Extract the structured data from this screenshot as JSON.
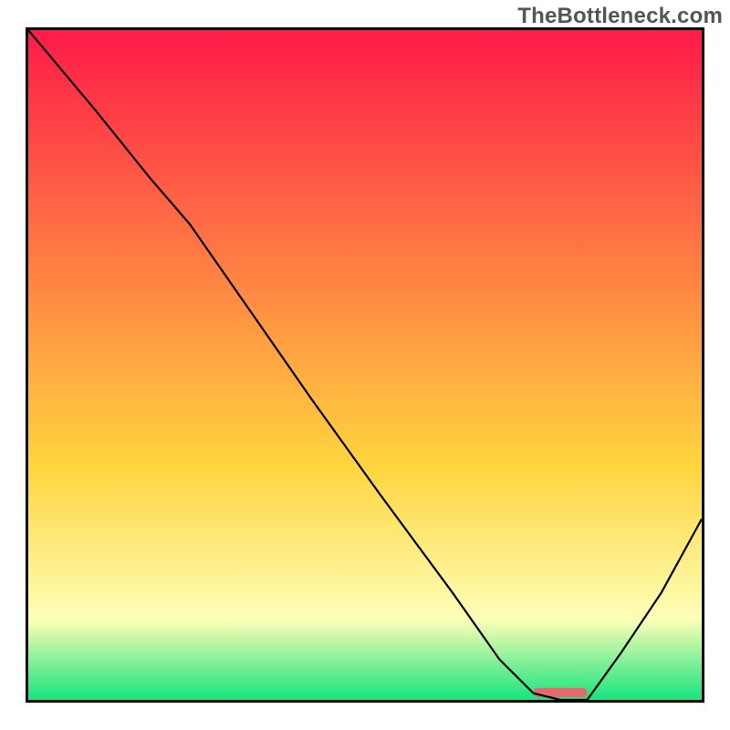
{
  "watermark": "TheBottleneck.com",
  "colors": {
    "gradient_top": "#fe1b48",
    "gradient_mid1": "#ff7544",
    "gradient_mid2": "#ffd53f",
    "gradient_pale": "#fdfeb7",
    "gradient_green": "#16e47d",
    "curve_stroke": "#000000",
    "marker_fill": "#e36a6e",
    "frame_stroke": "#000000"
  },
  "chart_data": {
    "type": "line",
    "title": "",
    "xlabel": "",
    "ylabel": "",
    "xlim": [
      0,
      100
    ],
    "ylim": [
      0,
      100
    ],
    "grid": false,
    "legend": null,
    "series": [
      {
        "name": "bottleneck-curve",
        "x": [
          0,
          10,
          18,
          24,
          33,
          42,
          52,
          63,
          70,
          75,
          79,
          83,
          88,
          94,
          100
        ],
        "y": [
          100,
          88,
          78,
          71,
          58,
          45,
          31,
          16,
          6,
          1,
          0,
          0,
          7,
          16,
          27
        ]
      }
    ],
    "marker": {
      "name": "optimal-range",
      "x_start": 75,
      "x_end": 83,
      "y": 0.4
    }
  }
}
